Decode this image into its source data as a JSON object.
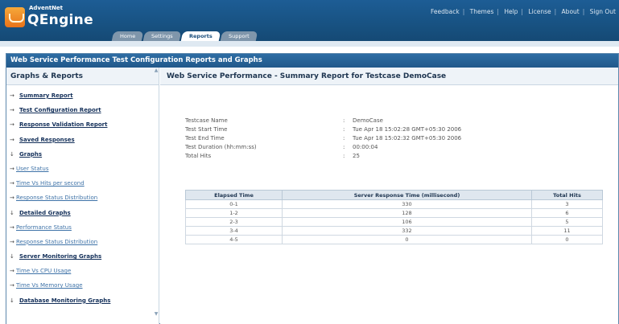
{
  "brand": {
    "company": "AdventNet",
    "product": "QEngine"
  },
  "top_links": [
    "Feedback",
    "Themes",
    "Help",
    "License",
    "About",
    "Sign Out"
  ],
  "tabs": [
    {
      "label": "Home",
      "active": false
    },
    {
      "label": "Settings",
      "active": false
    },
    {
      "label": "Reports",
      "active": true
    },
    {
      "label": "Support",
      "active": false
    }
  ],
  "window_title": "Web Service Performance Test Configuration Reports and Graphs",
  "left_nav": {
    "heading": "Graphs & Reports",
    "items": [
      {
        "label": "Summary Report",
        "marker": "→",
        "level": 0
      },
      {
        "label": "Test Configuration Report",
        "marker": "→",
        "level": 0
      },
      {
        "label": "Response Validation Report",
        "marker": "→",
        "level": 0
      },
      {
        "label": "Saved Responses",
        "marker": "→",
        "level": 0
      },
      {
        "label": "Graphs",
        "marker": "↓",
        "level": 0
      },
      {
        "label": "User Status",
        "marker": "→",
        "level": 1
      },
      {
        "label": "Time Vs Hits per second",
        "marker": "→",
        "level": 1
      },
      {
        "label": "Response Status Distribution",
        "marker": "→",
        "level": 1
      },
      {
        "label": "Detailed Graphs",
        "marker": "↓",
        "level": 0
      },
      {
        "label": "Performance Status",
        "marker": "→",
        "level": 1
      },
      {
        "label": "Response Status Distribution",
        "marker": "→",
        "level": 1
      },
      {
        "label": "Server Monitoring Graphs",
        "marker": "↓",
        "level": 0
      },
      {
        "label": "Time Vs CPU Usage",
        "marker": "→",
        "level": 1
      },
      {
        "label": "Time Vs Memory Usage",
        "marker": "→",
        "level": 1
      },
      {
        "label": "Database Monitoring Graphs",
        "marker": "↓",
        "level": 0
      }
    ]
  },
  "main": {
    "heading": "Web Service Performance - Summary Report for Testcase DemoCase",
    "summary": [
      {
        "label": "Testcase Name",
        "value": "DemoCase"
      },
      {
        "label": "Test Start Time",
        "value": "Tue Apr 18 15:02:28 GMT+05:30 2006"
      },
      {
        "label": "Test End Time",
        "value": "Tue Apr 18 15:02:32 GMT+05:30 2006"
      },
      {
        "label": "Test Duration (hh:mm:ss)",
        "value": "00:00:04"
      },
      {
        "label": "Total Hits",
        "value": "25"
      }
    ],
    "table": {
      "headers": [
        "Elapsed Time",
        "Server Response Time (millisecond)",
        "Total Hits"
      ],
      "rows": [
        [
          "0-1",
          "330",
          "3"
        ],
        [
          "1-2",
          "128",
          "6"
        ],
        [
          "2-3",
          "106",
          "5"
        ],
        [
          "3-4",
          "332",
          "11"
        ],
        [
          "4-5",
          "0",
          "0"
        ]
      ]
    }
  },
  "colors": {
    "header": "#1d5d95",
    "titlebar": "#2e6da4",
    "panel_head": "#eef3f8",
    "link": "#3f73a8"
  }
}
